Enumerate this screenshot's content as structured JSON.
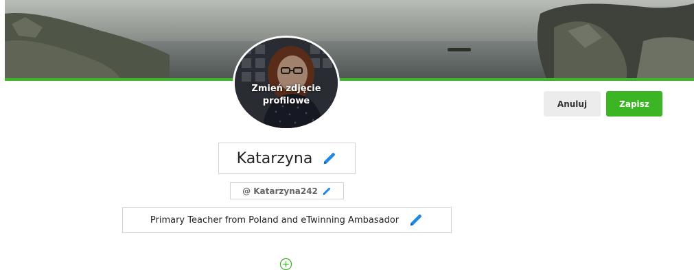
{
  "avatar": {
    "change_photo_label": "Zmień zdjęcie profilowe",
    "camera_icon": "camera-icon"
  },
  "actions": {
    "cancel_label": "Anuluj",
    "save_label": "Zapisz"
  },
  "profile": {
    "name": "Katarzyna",
    "handle": "@ Katarzyna242",
    "bio": "Primary Teacher from Poland and eTwinning Ambasador"
  },
  "icons": {
    "edit": "pencil-icon",
    "add": "plus-circle-icon"
  },
  "colors": {
    "accent_green": "#3bb524",
    "edit_icon_blue": "#1e88e5",
    "cover_bar": "#3fb52a"
  }
}
